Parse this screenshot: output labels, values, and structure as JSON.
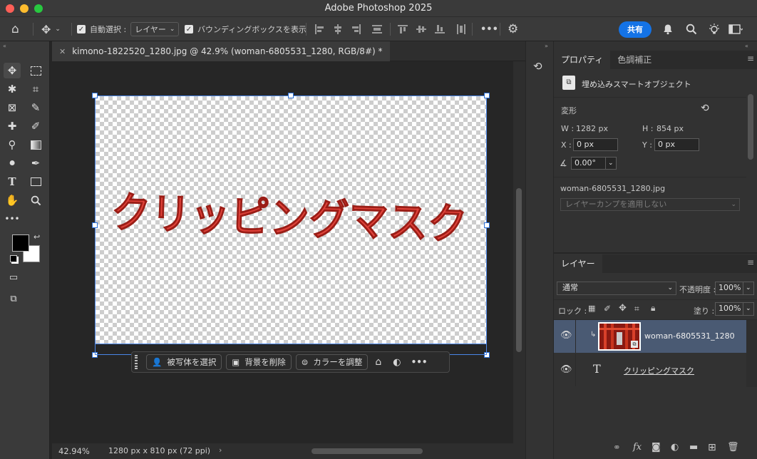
{
  "window": {
    "title": "Adobe Photoshop 2025"
  },
  "options": {
    "auto_select_label": "自動選択 :",
    "auto_select_value": "レイヤー",
    "bbox_label": "バウンディングボックスを表示",
    "more": "•••",
    "share_label": "共有"
  },
  "document": {
    "tab_title": "kimono-1822520_1280.jpg @ 42.9% (woman-6805531_1280, RGB/8#) *",
    "canvas_text": "クリッピングマスク",
    "zoom": "42.94%",
    "doc_info": "1280 px x 810 px (72 ppi)"
  },
  "context_bar": {
    "select_subject": "被写体を選択",
    "remove_bg": "背景を削除",
    "adjust_color": "カラーを調整"
  },
  "properties": {
    "tabs": [
      "プロパティ",
      "色調補正"
    ],
    "object_type": "埋め込みスマートオブジェクト",
    "transform_header": "変形",
    "w_label": "W :",
    "w_value": "1282 px",
    "h_label": "H :",
    "h_value": "854 px",
    "x_label": "X :",
    "x_value": "0 px",
    "y_label": "Y :",
    "y_value": "0 px",
    "angle_value": "0.00°",
    "file_name": "woman-6805531_1280.jpg",
    "layer_comp": "レイヤーカンプを適用しない"
  },
  "layers": {
    "tab": "レイヤー",
    "blend_mode": "通常",
    "opacity_label": "不透明度 :",
    "opacity_value": "100%",
    "lock_label": "ロック :",
    "fill_label": "塗り :",
    "fill_value": "100%",
    "items": [
      {
        "name": "woman-6805531_1280",
        "type": "smart-object",
        "clipped": true,
        "selected": true
      },
      {
        "name": "クリッピングマスク",
        "type": "text",
        "clipped": false,
        "selected": false
      }
    ],
    "thumb_label": "T"
  },
  "colors": {
    "accent": "#2b6fd6",
    "share": "#1473e6",
    "fg": "#000000",
    "bg": "#ffffff",
    "text_fill": "#e0423a"
  }
}
